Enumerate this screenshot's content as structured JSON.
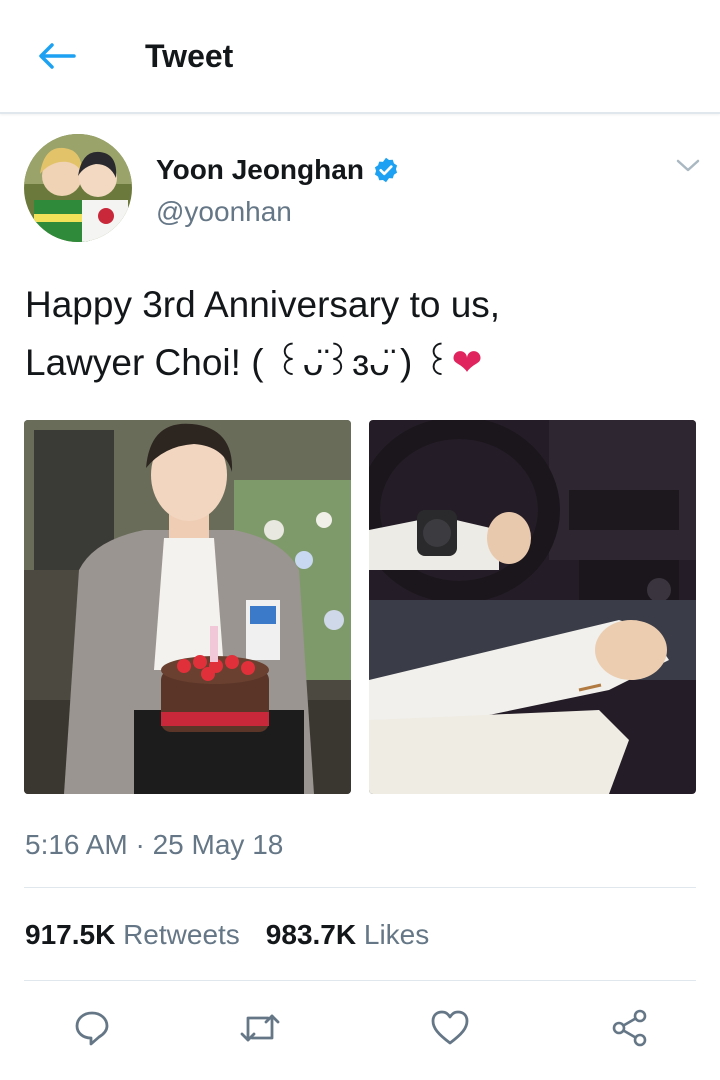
{
  "header": {
    "title": "Tweet"
  },
  "author": {
    "display_name": "Yoon Jeonghan",
    "handle": "@yoonhan"
  },
  "tweet": {
    "text_line1": "Happy 3rd Anniversary to us,",
    "text_line2": "Lawyer Choi! ( ꒰ᴗ̈꒱ɜᴗ̈ ) ꒰",
    "emoji": "❤"
  },
  "meta": {
    "timestamp": "5:16 AM · 25 May 18"
  },
  "stats": {
    "retweets_count": "917.5K",
    "retweets_label": "Retweets",
    "likes_count": "983.7K",
    "likes_label": "Likes"
  },
  "icons": {
    "back": "back-arrow-icon",
    "verified": "verified-badge-icon",
    "caret": "chevron-down-icon",
    "reply": "reply-icon",
    "retweet": "retweet-icon",
    "like": "heart-icon",
    "share": "share-icon"
  },
  "colors": {
    "accent": "#1da1f2",
    "muted": "#657786",
    "text": "#14171a",
    "divider": "#e1e8ed",
    "heart": "#e0245e"
  }
}
